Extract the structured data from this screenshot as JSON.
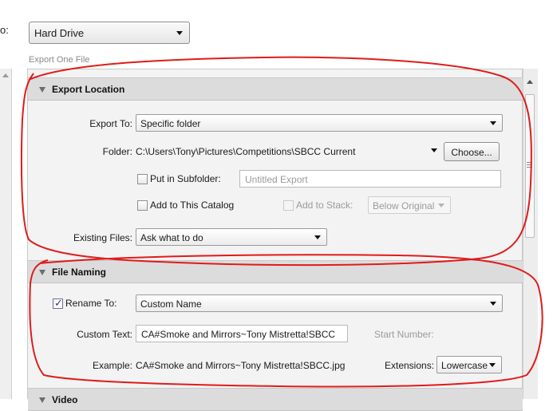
{
  "top": {
    "label_fragment": "o:",
    "export_to_value": "Hard Drive",
    "subcaption": "Export One File"
  },
  "export_location": {
    "title": "Export Location",
    "export_to_label": "Export To:",
    "export_to_value": "Specific folder",
    "folder_label": "Folder:",
    "folder_path": "C:\\Users\\Tony\\Pictures\\Competitions\\SBCC Current",
    "choose_button": "Choose...",
    "put_in_subfolder_label": "Put in Subfolder:",
    "subfolder_placeholder": "Untitled Export",
    "add_to_catalog_label": "Add to This Catalog",
    "add_to_stack_label": "Add to Stack:",
    "stack_position_value": "Below Original",
    "existing_files_label": "Existing Files:",
    "existing_files_value": "Ask what to do"
  },
  "file_naming": {
    "title": "File Naming",
    "rename_to_label": "Rename To:",
    "rename_to_checked": true,
    "rename_template_value": "Custom Name",
    "custom_text_label": "Custom Text:",
    "custom_text_value": "CA#Smoke and Mirrors~Tony Mistretta!SBCC",
    "start_number_label": "Start Number:",
    "example_label": "Example:",
    "example_value": "CA#Smoke and Mirrors~Tony Mistretta!SBCC.jpg",
    "extensions_label": "Extensions:",
    "extensions_value": "Lowercase"
  },
  "video": {
    "title": "Video"
  },
  "colors": {
    "annotation_red": "#e01b1b",
    "section_header_bg": "#dcdcdc",
    "panel_bg": "#f3f3f3"
  }
}
